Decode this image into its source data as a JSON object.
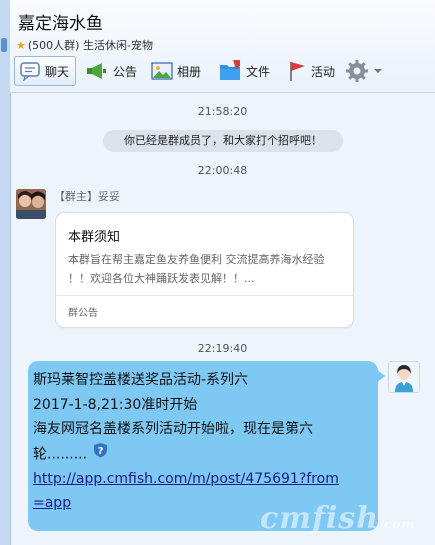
{
  "group": {
    "title": "嘉定海水鱼",
    "members": "(500人群)",
    "category": "生活休闲-宠物"
  },
  "toolbar": {
    "chat_label": "聊天",
    "notice_label": "公告",
    "album_label": "相册",
    "files_label": "文件",
    "activity_label": "活动"
  },
  "messages": {
    "time1": "21:58:20",
    "system_notice": "你已经是群成员了，和大家打个招呼吧！",
    "time2": "22:00:48",
    "sender_role": "【群主】",
    "sender_name": "妥妥",
    "card": {
      "title": "本群须知",
      "body": "本群旨在帮主嘉定鱼友养鱼便利 交流提高养海水经验 ！！欢迎各位大神踊跃发表见解！！...",
      "footer": "群公告"
    },
    "time3": "22:19:40",
    "post": {
      "line1": "斯玛莱智控盖楼送奖品活动-系列六",
      "line2": "2017-1-8,21:30准时开始",
      "line3": "海友网冠名盖楼系列活动开始啦，现在是第六轮.........",
      "link": "http://app.cmfish.com/m/post/475691?from=app"
    }
  },
  "watermark": "cmfish",
  "watermark_suffix": ".com",
  "icons": [
    "chat-icon",
    "megaphone-icon",
    "photo-icon",
    "folder-icon",
    "flag-icon",
    "gear-icon",
    "chevron-down-icon",
    "help-icon",
    "star-icon"
  ]
}
